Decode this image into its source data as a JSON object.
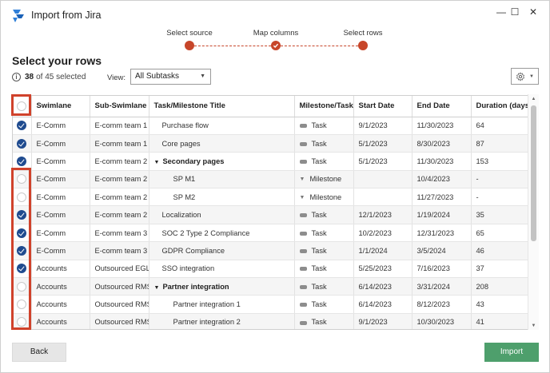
{
  "window": {
    "title": "Import from Jira",
    "minimize_label": "—",
    "maximize_label": "☐",
    "close_label": "✕"
  },
  "stepper": {
    "steps": [
      {
        "label": "Select source"
      },
      {
        "label": "Map columns"
      },
      {
        "label": "Select rows"
      }
    ]
  },
  "header": {
    "title": "Select your rows",
    "selected_count": "38",
    "selected_suffix": "of 45 selected",
    "view_label": "View:",
    "view_value": "All Subtasks"
  },
  "grid": {
    "columns": [
      "",
      "Swimlane",
      "Sub-Swimlane",
      "Task/Milestone Title",
      "Milestone/Task",
      "Start Date",
      "End Date",
      "Duration (days)"
    ],
    "rows": [
      {
        "checked": true,
        "swimlane": "E-Comm",
        "sub": "E-comm team 1",
        "title": "Purchase flow",
        "type": "Task",
        "start": "9/1/2023",
        "end": "11/30/2023",
        "duration": "64"
      },
      {
        "checked": true,
        "swimlane": "E-Comm",
        "sub": "E-comm team 1",
        "title": "Core pages",
        "type": "Task",
        "start": "5/1/2023",
        "end": "8/30/2023",
        "duration": "87"
      },
      {
        "checked": true,
        "swimlane": "E-Comm",
        "sub": "E-comm team 2",
        "title": "Secondary pages",
        "type": "Task",
        "start": "5/1/2023",
        "end": "11/30/2023",
        "duration": "153"
      },
      {
        "checked": false,
        "swimlane": "E-Comm",
        "sub": "E-comm team 2",
        "title": "SP M1",
        "type": "Milestone",
        "start": "",
        "end": "10/4/2023",
        "duration": "-"
      },
      {
        "checked": false,
        "swimlane": "E-Comm",
        "sub": "E-comm team 2",
        "title": "SP M2",
        "type": "Milestone",
        "start": "",
        "end": "11/27/2023",
        "duration": "-"
      },
      {
        "checked": true,
        "swimlane": "E-Comm",
        "sub": "E-comm team 2",
        "title": "Localization",
        "type": "Task",
        "start": "12/1/2023",
        "end": "1/19/2024",
        "duration": "35"
      },
      {
        "checked": true,
        "swimlane": "E-Comm",
        "sub": "E-comm team 3",
        "title": "SOC 2 Type 2 Compliance",
        "type": "Task",
        "start": "10/2/2023",
        "end": "12/31/2023",
        "duration": "65"
      },
      {
        "checked": true,
        "swimlane": "E-Comm",
        "sub": "E-comm team 3",
        "title": "GDPR Compliance",
        "type": "Task",
        "start": "1/1/2024",
        "end": "3/5/2024",
        "duration": "46"
      },
      {
        "checked": true,
        "swimlane": "Accounts",
        "sub": "Outsourced EGL",
        "title": "SSO integration",
        "type": "Task",
        "start": "5/25/2023",
        "end": "7/16/2023",
        "duration": "37"
      },
      {
        "checked": false,
        "swimlane": "Accounts",
        "sub": "Outsourced RMS",
        "title": "Partner integration",
        "type": "Task",
        "start": "6/14/2023",
        "end": "3/31/2024",
        "duration": "208"
      },
      {
        "checked": false,
        "swimlane": "Accounts",
        "sub": "Outsourced RMS",
        "title": "Partner integration 1",
        "type": "Task",
        "start": "6/14/2023",
        "end": "8/12/2023",
        "duration": "43"
      },
      {
        "checked": false,
        "swimlane": "Accounts",
        "sub": "Outsourced RMS",
        "title": "Partner integration 2",
        "type": "Task",
        "start": "9/1/2023",
        "end": "10/30/2023",
        "duration": "41"
      }
    ]
  },
  "footer": {
    "back_label": "Back",
    "import_label": "Import"
  },
  "colors": {
    "accent": "#c7462a",
    "checked": "#1f4b8f",
    "import_button": "#4e9f6c"
  }
}
